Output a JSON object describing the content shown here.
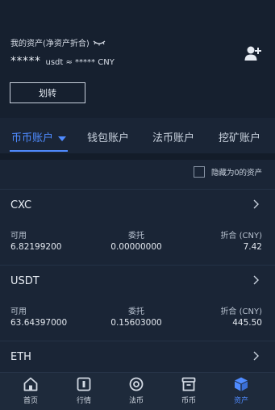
{
  "header": {
    "title": "我的资产(净资产折合)",
    "masked_amount": "*****",
    "equiv_text": "usdt ≈ ***** CNY",
    "transfer_label": "划转"
  },
  "tabs": [
    {
      "label": "币币账户",
      "active": true
    },
    {
      "label": "钱包账户",
      "active": false
    },
    {
      "label": "法币账户",
      "active": false
    },
    {
      "label": "挖矿账户",
      "active": false
    }
  ],
  "filter": {
    "hide_zero_label": "隐藏为0的资产",
    "checked": false
  },
  "columns": {
    "available": "可用",
    "frozen": "委托",
    "equiv": "折合 (CNY)"
  },
  "assets": [
    {
      "name": "CXC",
      "available": "6.82199200",
      "frozen": "0.00000000",
      "equiv": "7.42"
    },
    {
      "name": "USDT",
      "available": "63.64397000",
      "frozen": "0.15603000",
      "equiv": "445.50"
    },
    {
      "name": "ETH"
    }
  ],
  "nav": [
    {
      "label": "首页",
      "icon": "home-icon"
    },
    {
      "label": "行情",
      "icon": "market-icon"
    },
    {
      "label": "法币",
      "icon": "fiat-icon"
    },
    {
      "label": "币币",
      "icon": "exchange-icon"
    },
    {
      "label": "资产",
      "icon": "assets-icon",
      "active": true
    }
  ],
  "colors": {
    "accent": "#4f8bff",
    "background": "#1a2536",
    "header": "#16202f"
  }
}
